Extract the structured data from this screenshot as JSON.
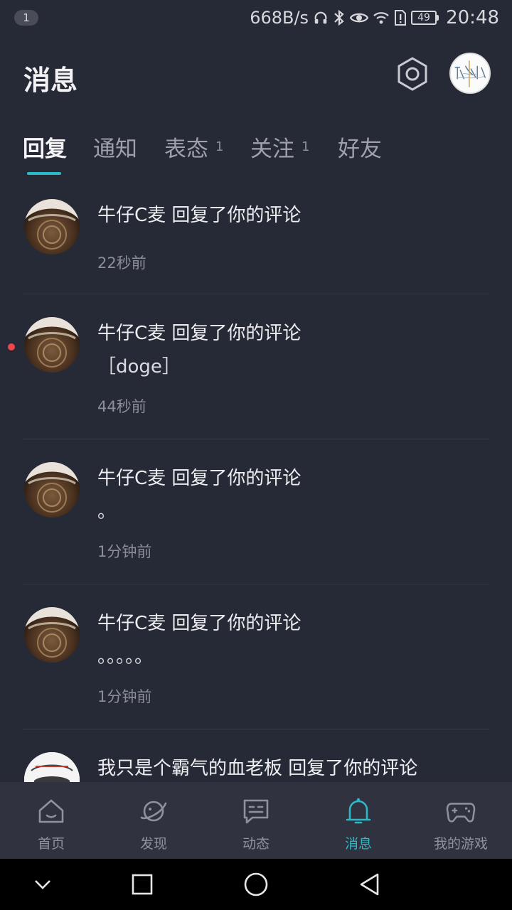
{
  "status_bar": {
    "notification_count": "1",
    "net_speed": "668B/s",
    "battery": "49",
    "time": "20:48"
  },
  "header": {
    "title": "消息",
    "settings_icon": "hexagon-gear-icon",
    "avatar_icon": "profile-avatar"
  },
  "tabs": [
    {
      "label": "回复",
      "count": "",
      "active": true
    },
    {
      "label": "通知",
      "count": ""
    },
    {
      "label": "表态",
      "count": "1"
    },
    {
      "label": "关注",
      "count": "1"
    },
    {
      "label": "好友",
      "count": ""
    }
  ],
  "messages": [
    {
      "title": "牛仔C麦 回复了你的评论",
      "body": "",
      "time": "22秒前",
      "unread": false
    },
    {
      "title": "牛仔C麦 回复了你的评论",
      "body": "［doge］",
      "time": "44秒前",
      "unread": true
    },
    {
      "title": "牛仔C麦 回复了你的评论",
      "body": "。",
      "time": "1分钟前",
      "unread": false
    },
    {
      "title": "牛仔C麦 回复了你的评论",
      "body": "。。。。。",
      "time": "1分钟前",
      "unread": false
    },
    {
      "title": "我只是个霸气的血老板 回复了你的评论",
      "body": "",
      "time": "",
      "unread": false
    }
  ],
  "bottom_nav": [
    {
      "label": "首页",
      "icon": "home-icon"
    },
    {
      "label": "发现",
      "icon": "planet-icon"
    },
    {
      "label": "动态",
      "icon": "feed-chat-icon"
    },
    {
      "label": "消息",
      "icon": "bell-icon",
      "active": true
    },
    {
      "label": "我的游戏",
      "icon": "gamepad-icon"
    }
  ],
  "colors": {
    "background": "#262936",
    "accent": "#2bbac5",
    "unread": "#f0454a"
  }
}
